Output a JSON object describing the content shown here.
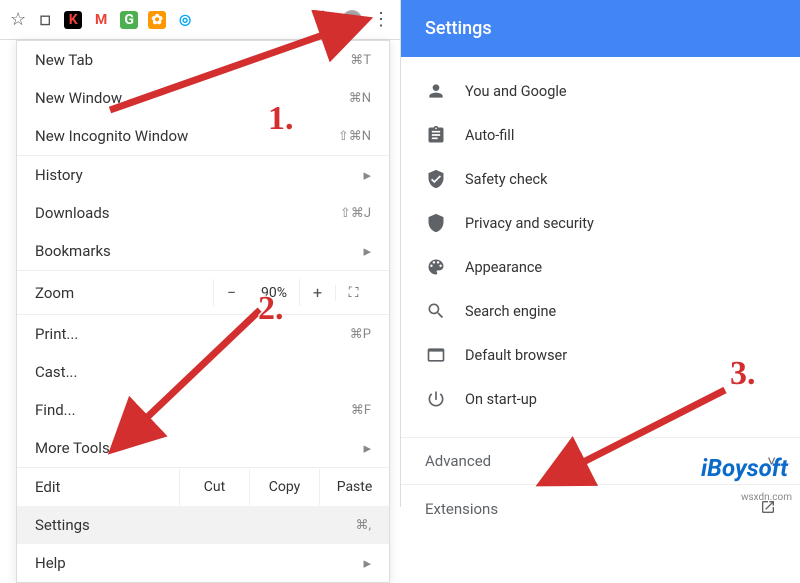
{
  "toolbar": {
    "star": "☆",
    "extensions": [
      {
        "bg": "#fff",
        "fg": "#555",
        "glyph": "◻"
      },
      {
        "bg": "#000",
        "fg": "#f44336",
        "glyph": "K"
      },
      {
        "bg": "#fff",
        "fg": "#ea4335",
        "glyph": "M"
      },
      {
        "bg": "#4caf50",
        "fg": "#fff",
        "glyph": "G"
      },
      {
        "bg": "#ff9800",
        "fg": "#fff",
        "glyph": "✿"
      },
      {
        "bg": "#fff",
        "fg": "#03a9f4",
        "glyph": "◎"
      }
    ],
    "puzzle_glyph": "✦",
    "dots_glyph": "⋮"
  },
  "menu": {
    "new_tab": {
      "label": "New Tab",
      "shortcut": "⌘T"
    },
    "new_window": {
      "label": "New Window",
      "shortcut": "⌘N"
    },
    "new_incognito": {
      "label": "New Incognito Window",
      "shortcut": "⇧⌘N"
    },
    "history": {
      "label": "History"
    },
    "downloads": {
      "label": "Downloads",
      "shortcut": "⇧⌘J"
    },
    "bookmarks": {
      "label": "Bookmarks"
    },
    "zoom": {
      "label": "Zoom",
      "minus": "−",
      "value": "90%",
      "plus": "+",
      "full": "⛶"
    },
    "print": {
      "label": "Print...",
      "shortcut": "⌘P"
    },
    "cast": {
      "label": "Cast..."
    },
    "find": {
      "label": "Find...",
      "shortcut": "⌘F"
    },
    "more_tools": {
      "label": "More Tools"
    },
    "edit": {
      "label": "Edit",
      "cut": "Cut",
      "copy": "Copy",
      "paste": "Paste"
    },
    "settings": {
      "label": "Settings",
      "shortcut": "⌘,"
    },
    "help": {
      "label": "Help"
    }
  },
  "settings": {
    "header": "Settings",
    "items": [
      {
        "label": "You and Google"
      },
      {
        "label": "Auto-fill"
      },
      {
        "label": "Safety check"
      },
      {
        "label": "Privacy and security"
      },
      {
        "label": "Appearance"
      },
      {
        "label": "Search engine"
      },
      {
        "label": "Default browser"
      },
      {
        "label": "On start-up"
      }
    ],
    "advanced": "Advanced",
    "extensions": "Extensions"
  },
  "annotations": {
    "step1": "1.",
    "step2": "2.",
    "step3": "3."
  },
  "watermark": "iBoysoft",
  "url_mark": "wsxdn.com"
}
